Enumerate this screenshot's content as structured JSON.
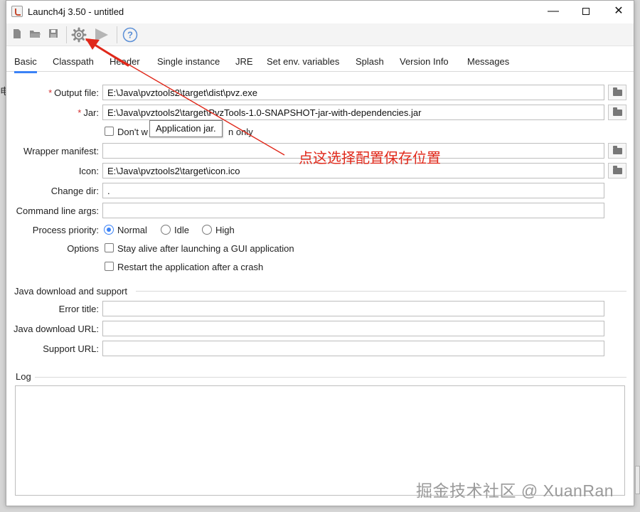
{
  "background_char": "电",
  "window": {
    "title": "Launch4j 3.50 - untitled",
    "minimize_symbol": "—",
    "close_symbol": "✕"
  },
  "toolbar": {
    "icons": [
      "new-file-icon",
      "open-folder-icon",
      "save-icon",
      "build-gear-icon",
      "run-icon",
      "help-icon"
    ],
    "help_symbol": "?"
  },
  "tabs": [
    "Basic",
    "Classpath",
    "Header",
    "Single instance",
    "JRE",
    "Set env. variables",
    "Splash",
    "Version Info",
    "Messages"
  ],
  "active_tab": "Basic",
  "basic": {
    "required_mark": "*",
    "output_file": {
      "label": "Output file:",
      "value": "E:\\Java\\pvztools2\\target\\dist\\pvz.exe"
    },
    "jar": {
      "label": "Jar:",
      "value": "E:\\Java\\pvztools2\\target\\PvzTools-1.0-SNAPSHOT-jar-with-dependencies.jar"
    },
    "dont_wrap": {
      "label_start": "Don't w",
      "label_end": "n only",
      "checked": false
    },
    "tooltip": "Application jar.",
    "wrapper_manifest": {
      "label": "Wrapper manifest:",
      "value": ""
    },
    "icon": {
      "label": "Icon:",
      "value": "E:\\Java\\pvztools2\\target\\icon.ico"
    },
    "change_dir": {
      "label": "Change dir:",
      "value": "."
    },
    "cmd_args": {
      "label": "Command line args:",
      "value": ""
    },
    "priority": {
      "label": "Process priority:",
      "options": [
        "Normal",
        "Idle",
        "High"
      ],
      "selected": "Normal"
    },
    "options": {
      "label": "Options",
      "stay_alive": {
        "label": "Stay alive after launching a GUI application",
        "checked": false
      },
      "restart": {
        "label": "Restart the application after a crash",
        "checked": false
      }
    }
  },
  "java_download": {
    "title": "Java download and support",
    "error_title": {
      "label": "Error title:",
      "value": ""
    },
    "download_url": {
      "label": "Java download URL:",
      "value": ""
    },
    "support_url": {
      "label": "Support URL:",
      "value": ""
    }
  },
  "log": {
    "title": "Log",
    "content": ""
  },
  "annotation": {
    "text": "点这选择配置保存位置",
    "color": "#e0281a"
  },
  "watermark": "掘金技术社区 @ XuanRan",
  "colors": {
    "accent": "#3b82f6",
    "required": "#d32f2f"
  }
}
